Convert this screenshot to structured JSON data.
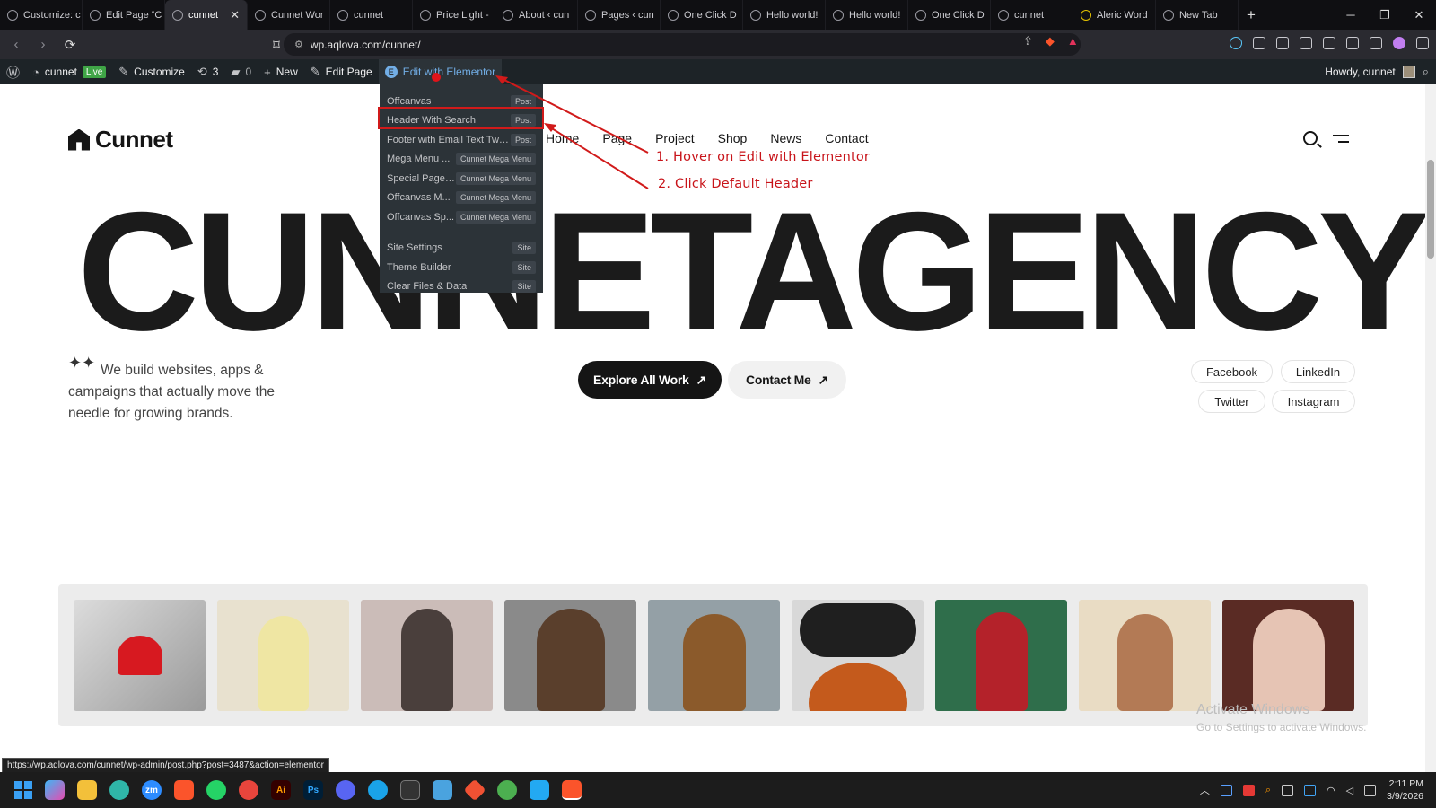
{
  "browser": {
    "tabs": [
      {
        "label": "Customize: c",
        "active": false
      },
      {
        "label": "Edit Page “C",
        "active": false
      },
      {
        "label": "cunnet",
        "active": true
      },
      {
        "label": "Cunnet Wor",
        "active": false
      },
      {
        "label": "cunnet",
        "active": false
      },
      {
        "label": "Price Light -",
        "active": false
      },
      {
        "label": "About ‹ cun",
        "active": false
      },
      {
        "label": "Pages ‹ cun",
        "active": false
      },
      {
        "label": "One Click D",
        "active": false
      },
      {
        "label": "Hello world!",
        "active": false
      },
      {
        "label": "Hello world!",
        "active": false
      },
      {
        "label": "One Click D",
        "active": false
      },
      {
        "label": "cunnet",
        "active": false
      },
      {
        "label": "Aleric Word",
        "active": false
      },
      {
        "label": "New Tab",
        "active": false
      }
    ],
    "new_tab": "+",
    "url": "wp.aqlova.com/cunnet/",
    "status_url": "https://wp.aqlova.com/cunnet/wp-admin/post.php?post=3487&action=elementor"
  },
  "adminbar": {
    "site": "cunnet",
    "live": "Live",
    "customize": "Customize",
    "updates": "3",
    "comments": "0",
    "new": "New",
    "edit_page": "Edit Page",
    "elementor": "Edit with Elementor",
    "howdy": "Howdy, cunnet"
  },
  "dropdown": {
    "group1": [
      {
        "label": "Offcanvas",
        "tag": "Post"
      },
      {
        "label": "Header With Search",
        "tag": "Post"
      },
      {
        "label": "Footer with Email Text Two...",
        "tag": "Post"
      },
      {
        "label": "Mega Menu ...",
        "tag": "Cunnet Mega Menu"
      },
      {
        "label": "Special Pages...",
        "tag": "Cunnet Mega Menu"
      },
      {
        "label": "Offcanvas M...",
        "tag": "Cunnet Mega Menu"
      },
      {
        "label": "Offcanvas Sp...",
        "tag": "Cunnet Mega Menu"
      }
    ],
    "group2": [
      {
        "label": "Site Settings",
        "tag": "Site"
      },
      {
        "label": "Theme Builder",
        "tag": "Site"
      },
      {
        "label": "Clear Files & Data",
        "tag": "Site"
      }
    ]
  },
  "annotations": {
    "step1": "1. Hover on Edit with Elementor",
    "step2": "2. Click Default Header"
  },
  "site": {
    "logo": "Cunnet",
    "menu": [
      "Home",
      "Page",
      "Project",
      "Shop",
      "News",
      "Contact"
    ],
    "hero": "CUNNETAGENCY",
    "tagline": "We build websites, apps & campaigns that actually move the needle for growing brands.",
    "cta_primary": "Explore All Work",
    "cta_secondary": "Contact Me",
    "arrow": "↗",
    "social": [
      "Facebook",
      "LinkedIn",
      "Twitter",
      "Instagram"
    ]
  },
  "watermark": {
    "line1": "Activate Windows",
    "line2": "Go to Settings to activate Windows."
  },
  "taskbar": {
    "time": "2:11 PM",
    "date": "3/9/2026"
  },
  "colors": {
    "admin_bar": "#1d2327",
    "elementor_blue": "#72aee6",
    "annotation_red": "#d11a1a"
  }
}
